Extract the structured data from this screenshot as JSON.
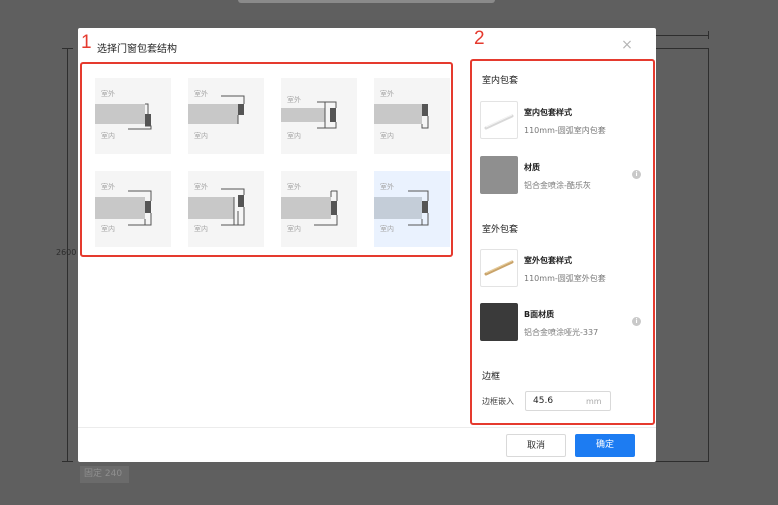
{
  "background": {
    "dimension_label": "2600",
    "badge_text": "固定 240"
  },
  "dialog": {
    "title": "选择门窗包套结构",
    "close_icon": "×",
    "annotations": [
      "1",
      "2"
    ],
    "structure_options": [
      {
        "outside": "室外",
        "inside": "室内",
        "selected": false
      },
      {
        "outside": "室外",
        "inside": "室内",
        "selected": false
      },
      {
        "outside": "室外",
        "inside": "室内",
        "selected": false
      },
      {
        "outside": "室外",
        "inside": "室内",
        "selected": false
      },
      {
        "outside": "室外",
        "inside": "室内",
        "selected": false
      },
      {
        "outside": "室外",
        "inside": "室内",
        "selected": false
      },
      {
        "outside": "室外",
        "inside": "室内",
        "selected": false
      },
      {
        "outside": "室外",
        "inside": "室内",
        "selected": true
      }
    ],
    "indoor": {
      "section_title": "室内包套",
      "style_name": "室内包套样式",
      "style_desc": "110mm-圆弧室内包套",
      "material_name": "材质",
      "material_desc": "铝合金喷涂-酷乐灰"
    },
    "outdoor": {
      "section_title": "室外包套",
      "style_name": "室外包套样式",
      "style_desc": "110mm-圆弧室外包套",
      "material_name": "B面材质",
      "material_desc": "铝合金喷涂哑光-337"
    },
    "frame": {
      "section_title": "边框",
      "inset_label": "边框嵌入",
      "inset_value": "45.6",
      "inset_unit": "mm"
    },
    "info_icon": "i",
    "cancel_label": "取消",
    "ok_label": "确定"
  },
  "colors": {
    "accent": "#1d7cf2",
    "annotation": "#e53a2e",
    "selected_card": "#eaf2fe"
  }
}
